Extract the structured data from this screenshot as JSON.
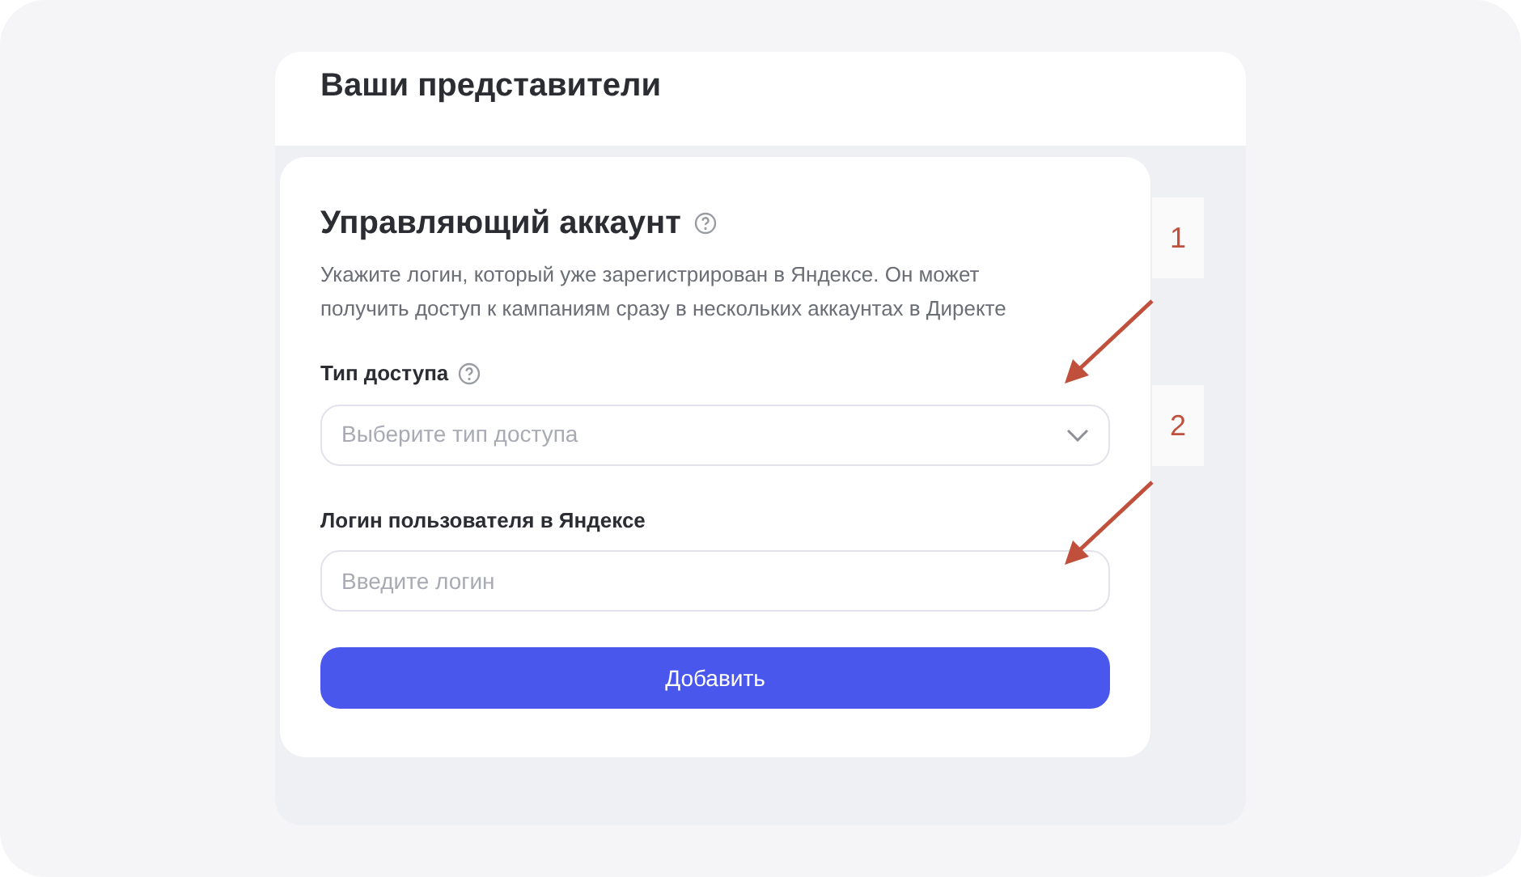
{
  "header": {
    "title": "Ваши представители"
  },
  "card": {
    "title": "Управляющий аккаунт",
    "description": "Укажите логин, который уже зарегистрирован в Яндексе. Он может получить доступ к кампаниям сразу в нескольких аккаунтах в Директе",
    "fields": [
      {
        "kind": "select",
        "label": "Тип доступа",
        "help": true,
        "placeholder": "Выберите тип доступа"
      },
      {
        "kind": "input",
        "label": "Логин пользователя в Яндексе",
        "help": false,
        "placeholder": "Введите логин"
      }
    ],
    "button": "Добавить"
  },
  "callouts": [
    "1",
    "2"
  ]
}
